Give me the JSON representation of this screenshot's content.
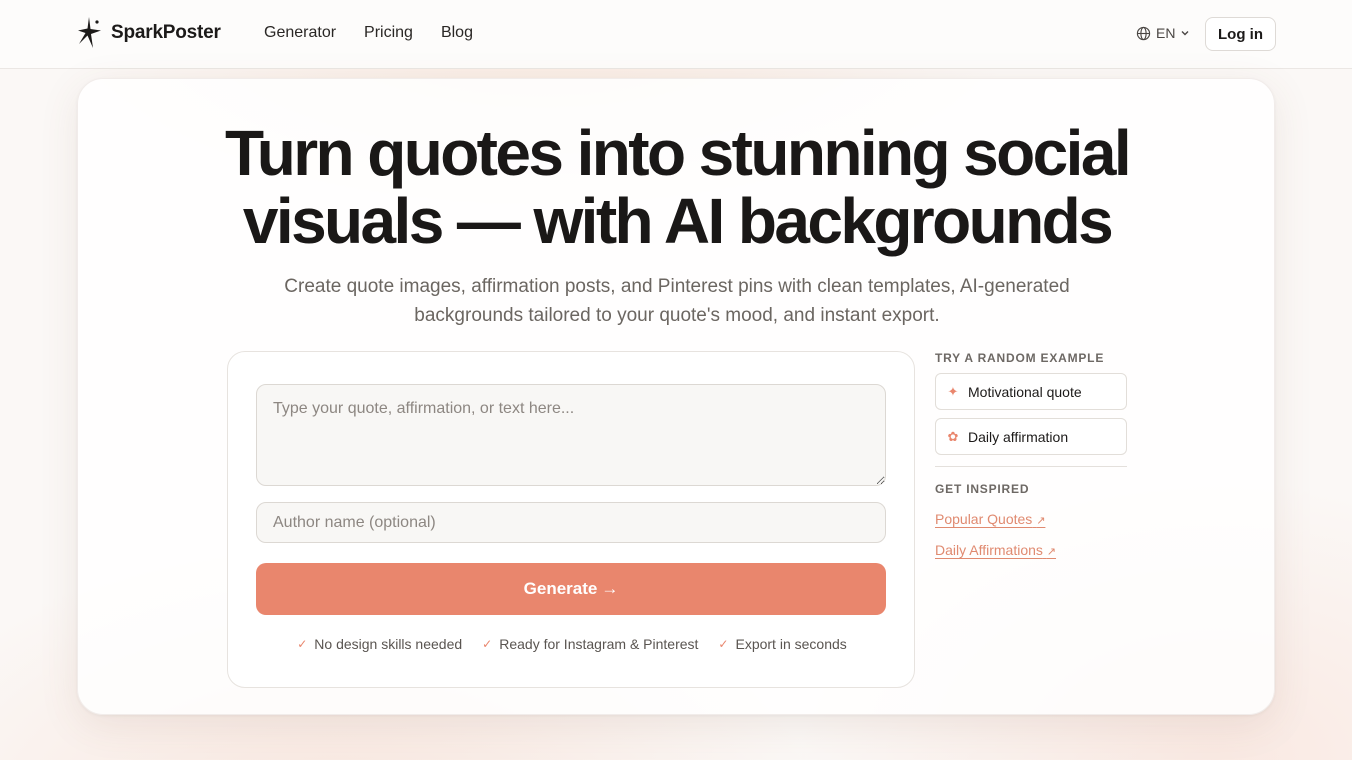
{
  "header": {
    "brand_name": "SparkPoster",
    "nav": [
      {
        "label": "Generator"
      },
      {
        "label": "Pricing"
      },
      {
        "label": "Blog"
      }
    ],
    "language": "EN",
    "login_label": "Log in"
  },
  "hero": {
    "headline_line1": "Turn quotes into stunning social",
    "headline_line2": "visuals — with AI backgrounds",
    "subheadline_line1": "Create quote images, affirmation posts, and Pinterest pins with clean templates, AI-generated",
    "subheadline_line2": "backgrounds tailored to your quote's mood, and instant export."
  },
  "form": {
    "quote_placeholder": "Type your quote, affirmation, or text here...",
    "quote_value": "",
    "author_placeholder": "Author name (optional)",
    "author_value": "",
    "generate_label": "Generate",
    "generate_arrow": "→",
    "features": [
      {
        "icon": "check-icon",
        "label": "No design skills needed"
      },
      {
        "icon": "check-icon",
        "label": "Ready for Instagram & Pinterest"
      },
      {
        "icon": "check-icon",
        "label": "Export in seconds"
      }
    ]
  },
  "sidebar": {
    "examples_heading": "TRY A RANDOM EXAMPLE",
    "examples": [
      {
        "icon": "sparkle-icon",
        "glyph": "✦",
        "label": "Motivational quote"
      },
      {
        "icon": "flower-icon",
        "glyph": "✿",
        "label": "Daily affirmation"
      }
    ],
    "inspire_heading": "GET INSPIRED",
    "links": [
      {
        "label": "Popular Quotes",
        "arrow": "↗"
      },
      {
        "label": "Daily Affirmations",
        "arrow": "↗"
      }
    ]
  },
  "colors": {
    "accent": "#e9866d",
    "link": "#e08a70",
    "text": "#1c1a19",
    "muted": "#6b6661"
  }
}
